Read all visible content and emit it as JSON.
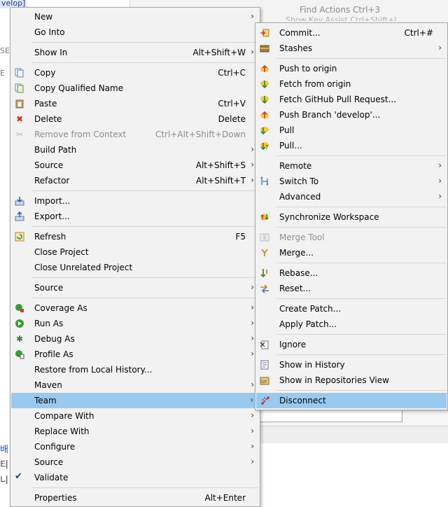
{
  "background": {
    "crumb": "velop]",
    "hint": "Find Actions  Ctrl+3",
    "hint2": "Show Key Assist  Ctrl+Shift+L",
    "side_text_1": "SE",
    "side_text_2": "E",
    "bottom_left": [
      "배 ",
      "티 는",
      "니 다"
    ]
  },
  "main_menu": {
    "new": {
      "label": "New"
    },
    "go_into": {
      "label": "Go Into"
    },
    "show_in": {
      "label": "Show In",
      "accel": "Alt+Shift+W"
    },
    "copy": {
      "label": "Copy",
      "accel": "Ctrl+C"
    },
    "copy_qualified_name": {
      "label": "Copy Qualified Name"
    },
    "paste": {
      "label": "Paste",
      "accel": "Ctrl+V"
    },
    "delete": {
      "label": "Delete",
      "accel": "Delete"
    },
    "remove_from_context": {
      "label": "Remove from Context",
      "accel": "Ctrl+Alt+Shift+Down"
    },
    "build_path": {
      "label": "Build Path"
    },
    "source": {
      "label": "Source",
      "accel": "Alt+Shift+S"
    },
    "refactor": {
      "label": "Refactor",
      "accel": "Alt+Shift+T"
    },
    "import": {
      "label": "Import..."
    },
    "export": {
      "label": "Export..."
    },
    "refresh": {
      "label": "Refresh",
      "accel": "F5"
    },
    "close_project": {
      "label": "Close Project"
    },
    "close_unrelated_project": {
      "label": "Close Unrelated Project"
    },
    "source2": {
      "label": "Source"
    },
    "coverage_as": {
      "label": "Coverage As"
    },
    "run_as": {
      "label": "Run As"
    },
    "debug_as": {
      "label": "Debug As"
    },
    "profile_as": {
      "label": "Profile As"
    },
    "restore_local_history": {
      "label": "Restore from Local History..."
    },
    "maven": {
      "label": "Maven"
    },
    "team": {
      "label": "Team"
    },
    "compare_with": {
      "label": "Compare With"
    },
    "replace_with": {
      "label": "Replace With"
    },
    "configure": {
      "label": "Configure"
    },
    "source3": {
      "label": "Source"
    },
    "validate": {
      "label": "Validate"
    },
    "properties": {
      "label": "Properties",
      "accel": "Alt+Enter"
    }
  },
  "team_menu": {
    "commit": {
      "label": "Commit...",
      "accel": "Ctrl+#"
    },
    "stashes": {
      "label": "Stashes"
    },
    "push_to_origin": {
      "label": "Push to origin"
    },
    "fetch_from_origin": {
      "label": "Fetch from origin"
    },
    "fetch_github_pr": {
      "label": "Fetch GitHub Pull Request..."
    },
    "push_branch": {
      "label": "Push Branch 'develop'..."
    },
    "pull": {
      "label": "Pull"
    },
    "pull_dialog": {
      "label": "Pull..."
    },
    "remote": {
      "label": "Remote"
    },
    "switch_to": {
      "label": "Switch To"
    },
    "advanced": {
      "label": "Advanced"
    },
    "synchronize": {
      "label": "Synchronize Workspace"
    },
    "merge_tool": {
      "label": "Merge Tool"
    },
    "merge": {
      "label": "Merge..."
    },
    "rebase": {
      "label": "Rebase..."
    },
    "reset": {
      "label": "Reset..."
    },
    "create_patch": {
      "label": "Create Patch..."
    },
    "apply_patch": {
      "label": "Apply Patch..."
    },
    "ignore": {
      "label": "Ignore"
    },
    "show_in_history": {
      "label": "Show in History"
    },
    "show_in_repositories": {
      "label": "Show in Repositories View"
    },
    "disconnect": {
      "label": "Disconnect"
    }
  },
  "colors": {
    "menu_bg": "#f2f2f2",
    "selection": "#99c9ef",
    "disabled_text": "#8d8d8d"
  }
}
